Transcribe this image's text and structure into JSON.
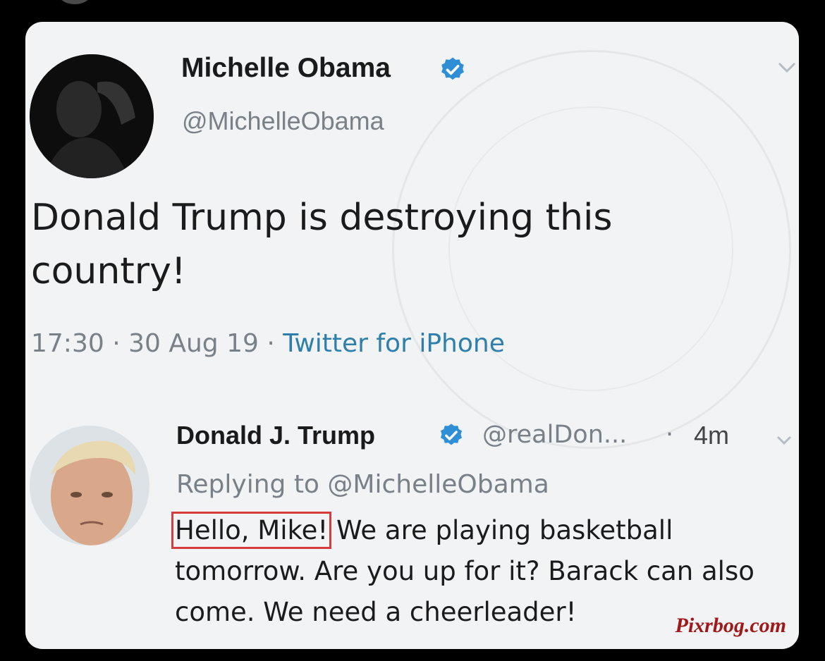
{
  "tweet": {
    "author_name": "Michelle Obama",
    "author_handle": "@MichelleObama",
    "text": "Donald Trump is destroying this country!",
    "time": "17:30",
    "date": "30 Aug 19",
    "separator": "·",
    "source": "Twitter for iPhone"
  },
  "reply": {
    "author_name": "Donald J. Trump",
    "author_handle": "@realDon...",
    "age_separator": "·",
    "age": "4m",
    "replying_to_label": "Replying to",
    "replying_to_handle": "@MichelleObama",
    "text_highlight": "Hello, Mike!",
    "text_rest": " We are playing basketball tomorrow. Are you up for it? Barack can also come. We need a cheerleader!"
  },
  "watermark": "Pixrbog.com",
  "icons": {
    "verified": "verified-badge-icon",
    "more": "chevron-down-icon"
  },
  "colors": {
    "verified": "#2f8fd6",
    "link_gray": "#7a8087",
    "source_blue": "#2f7fad",
    "highlight_box": "#d63c3c",
    "watermark": "#a01818"
  }
}
